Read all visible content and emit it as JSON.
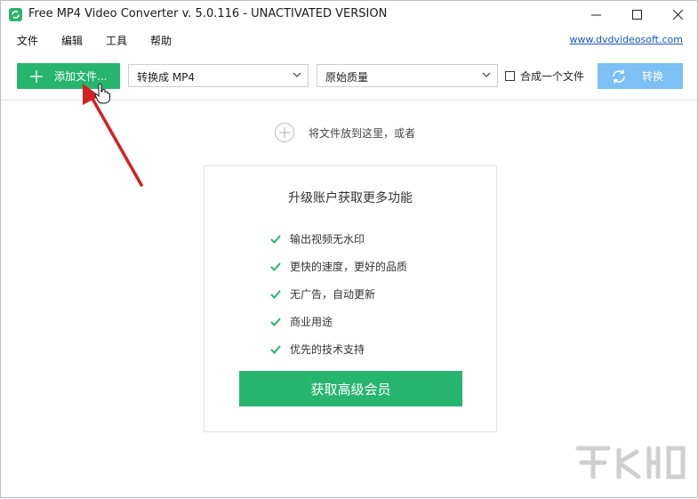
{
  "window": {
    "title": "Free MP4 Video Converter v. 5.0.116 - UNACTIVATED VERSION",
    "icons": {
      "app": "app-logo-icon",
      "minimize": "minimize-icon",
      "maximize": "maximize-icon",
      "close": "close-icon"
    }
  },
  "menu": {
    "items": [
      {
        "label": "文件"
      },
      {
        "label": "编辑"
      },
      {
        "label": "工具"
      },
      {
        "label": "帮助"
      }
    ],
    "site_link": "www.dvdvideosoft.com"
  },
  "toolbar": {
    "add_files_label": "添加文件...",
    "format_select_value": "转换成 MP4",
    "quality_select_value": "原始质量",
    "merge_label": "合成一个文件",
    "merge_checked": false,
    "convert_label": "转换"
  },
  "drop_hint": {
    "text": "将文件放到这里，或者"
  },
  "upgrade_card": {
    "title": "升级账户获取更多功能",
    "features": [
      "输出视频无水印",
      "更快的速度，更好的品质",
      "无广告，自动更新",
      "商业用途",
      "优先的技术支持"
    ],
    "button_label": "获取高级会员"
  },
  "colors": {
    "accent_green": "#27b56e",
    "convert_blue": "#7cc0f4",
    "link_blue": "#1a56c7",
    "annotation_red": "#d42020"
  }
}
